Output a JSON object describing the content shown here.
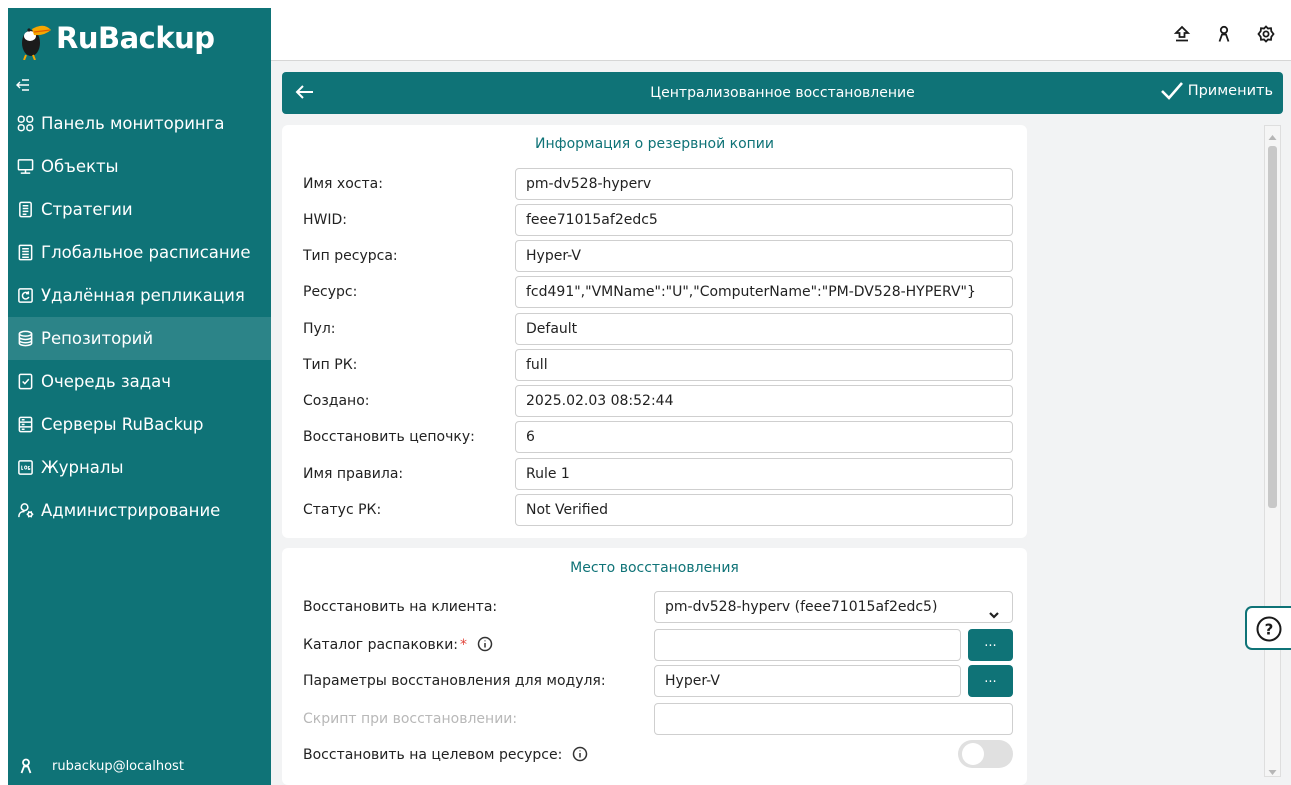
{
  "app": {
    "logo_text": "RuBackup",
    "user": "rubackup@localhost"
  },
  "sidebar": {
    "collapse_icon": "collapse-menu-icon",
    "items": [
      {
        "label": "Панель мониторинга",
        "icon": "dashboard-icon",
        "active": false
      },
      {
        "label": "Объекты",
        "icon": "monitor-icon",
        "active": false
      },
      {
        "label": "Стратегии",
        "icon": "document-icon",
        "active": false
      },
      {
        "label": "Глобальное расписание",
        "icon": "list-icon",
        "active": false
      },
      {
        "label": "Удалённая репликация",
        "icon": "replication-icon",
        "active": false
      },
      {
        "label": "Репозиторий",
        "icon": "database-icon",
        "active": true
      },
      {
        "label": "Очередь задач",
        "icon": "checklist-icon",
        "active": false
      },
      {
        "label": "Серверы RuBackup",
        "icon": "server-icon",
        "active": false
      },
      {
        "label": "Журналы",
        "icon": "log-icon",
        "active": false
      },
      {
        "label": "Администрирование",
        "icon": "admin-icon",
        "active": false
      }
    ]
  },
  "topbar": {
    "icons": [
      "upload-icon",
      "user-icon",
      "settings-icon"
    ]
  },
  "header": {
    "title": "Централизованное восстановление",
    "apply_label": "Применить"
  },
  "backup_info": {
    "title": "Информация о резервной копии",
    "fields": [
      {
        "label": "Имя хоста:",
        "value": "pm-dv528-hyperv"
      },
      {
        "label": "HWID:",
        "value": "feee71015af2edc5"
      },
      {
        "label": "Тип ресурса:",
        "value": "Hyper-V"
      },
      {
        "label": "Ресурс:",
        "value": "fcd491\",\"VMName\":\"U\",\"ComputerName\":\"PM-DV528-HYPERV\"}"
      },
      {
        "label": "Пул:",
        "value": "Default"
      },
      {
        "label": "Тип РК:",
        "value": "full"
      },
      {
        "label": "Создано:",
        "value": "2025.02.03 08:52:44"
      },
      {
        "label": "Восстановить цепочку:",
        "value": "6"
      },
      {
        "label": "Имя правила:",
        "value": "Rule 1"
      },
      {
        "label": "Статус РК:",
        "value": "Not Verified"
      }
    ]
  },
  "restore_location": {
    "title": "Место восстановления",
    "client_label": "Восстановить на клиента:",
    "client_value": "pm-dv528-hyperv (feee71015af2edc5)",
    "unpack_label": "Каталог распаковки:",
    "unpack_required": "*",
    "unpack_value": "",
    "module_params_label": "Параметры восстановления для модуля:",
    "module_params_value": "Hyper-V",
    "script_label": "Скрипт при восстановлении:",
    "script_value": "",
    "target_label": "Восстановить на целевом ресурсе:",
    "target_enabled": false,
    "dots_label": "..."
  },
  "colors": {
    "accent": "#0f7377",
    "sidebar_active": "#2c8488",
    "required": "#e2463c"
  }
}
